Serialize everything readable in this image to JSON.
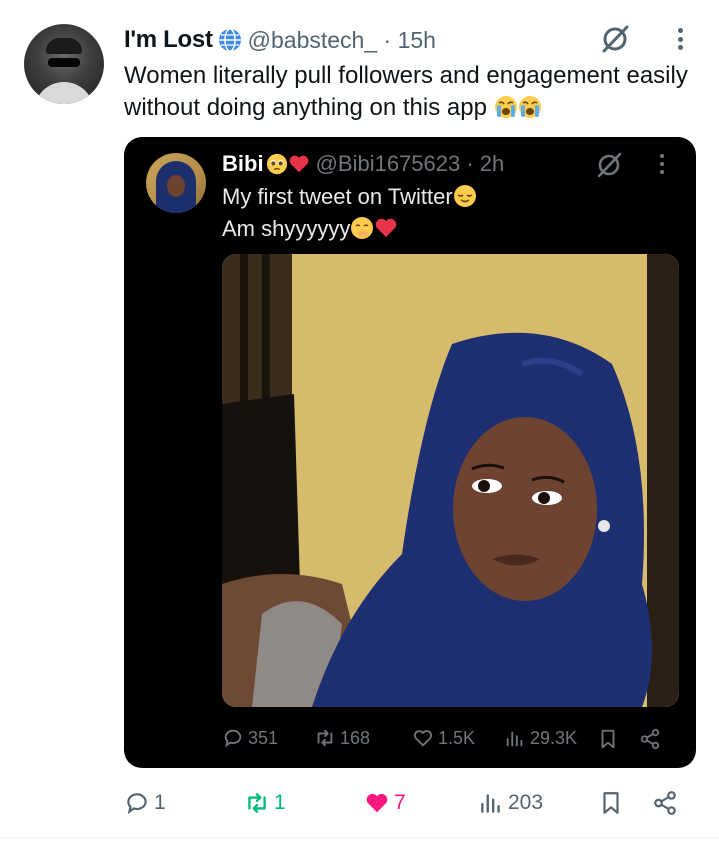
{
  "post": {
    "author_name": "I'm Lost",
    "handle_time": "@babstech_ · 15h",
    "text": "Women literally pull followers and engagement easily without doing anything on this app",
    "icons": [
      "globe-icon",
      "grok-icon",
      "more-icon",
      "crying-face-emoji"
    ]
  },
  "quote": {
    "author_name": "Bibi",
    "handle_time": "@Bibi1675623 · 2h",
    "line1": "My first tweet on Twitter",
    "line2": "Am shyyyyyy",
    "stats": {
      "replies": "351",
      "reposts": "168",
      "likes": "1.5K",
      "views": "29.3K"
    },
    "icons": [
      "pleading-face-emoji",
      "red-heart-emoji",
      "relieved-face-emoji",
      "face-with-hand-emoji"
    ]
  },
  "actions": {
    "replies": "1",
    "reposts": "1",
    "likes": "7",
    "views": "203"
  },
  "colors": {
    "text": "#0f1419",
    "secondary": "#536471",
    "retweet_green": "#00ba7c",
    "like_pink": "#f91880",
    "quote_bg": "#000000"
  }
}
